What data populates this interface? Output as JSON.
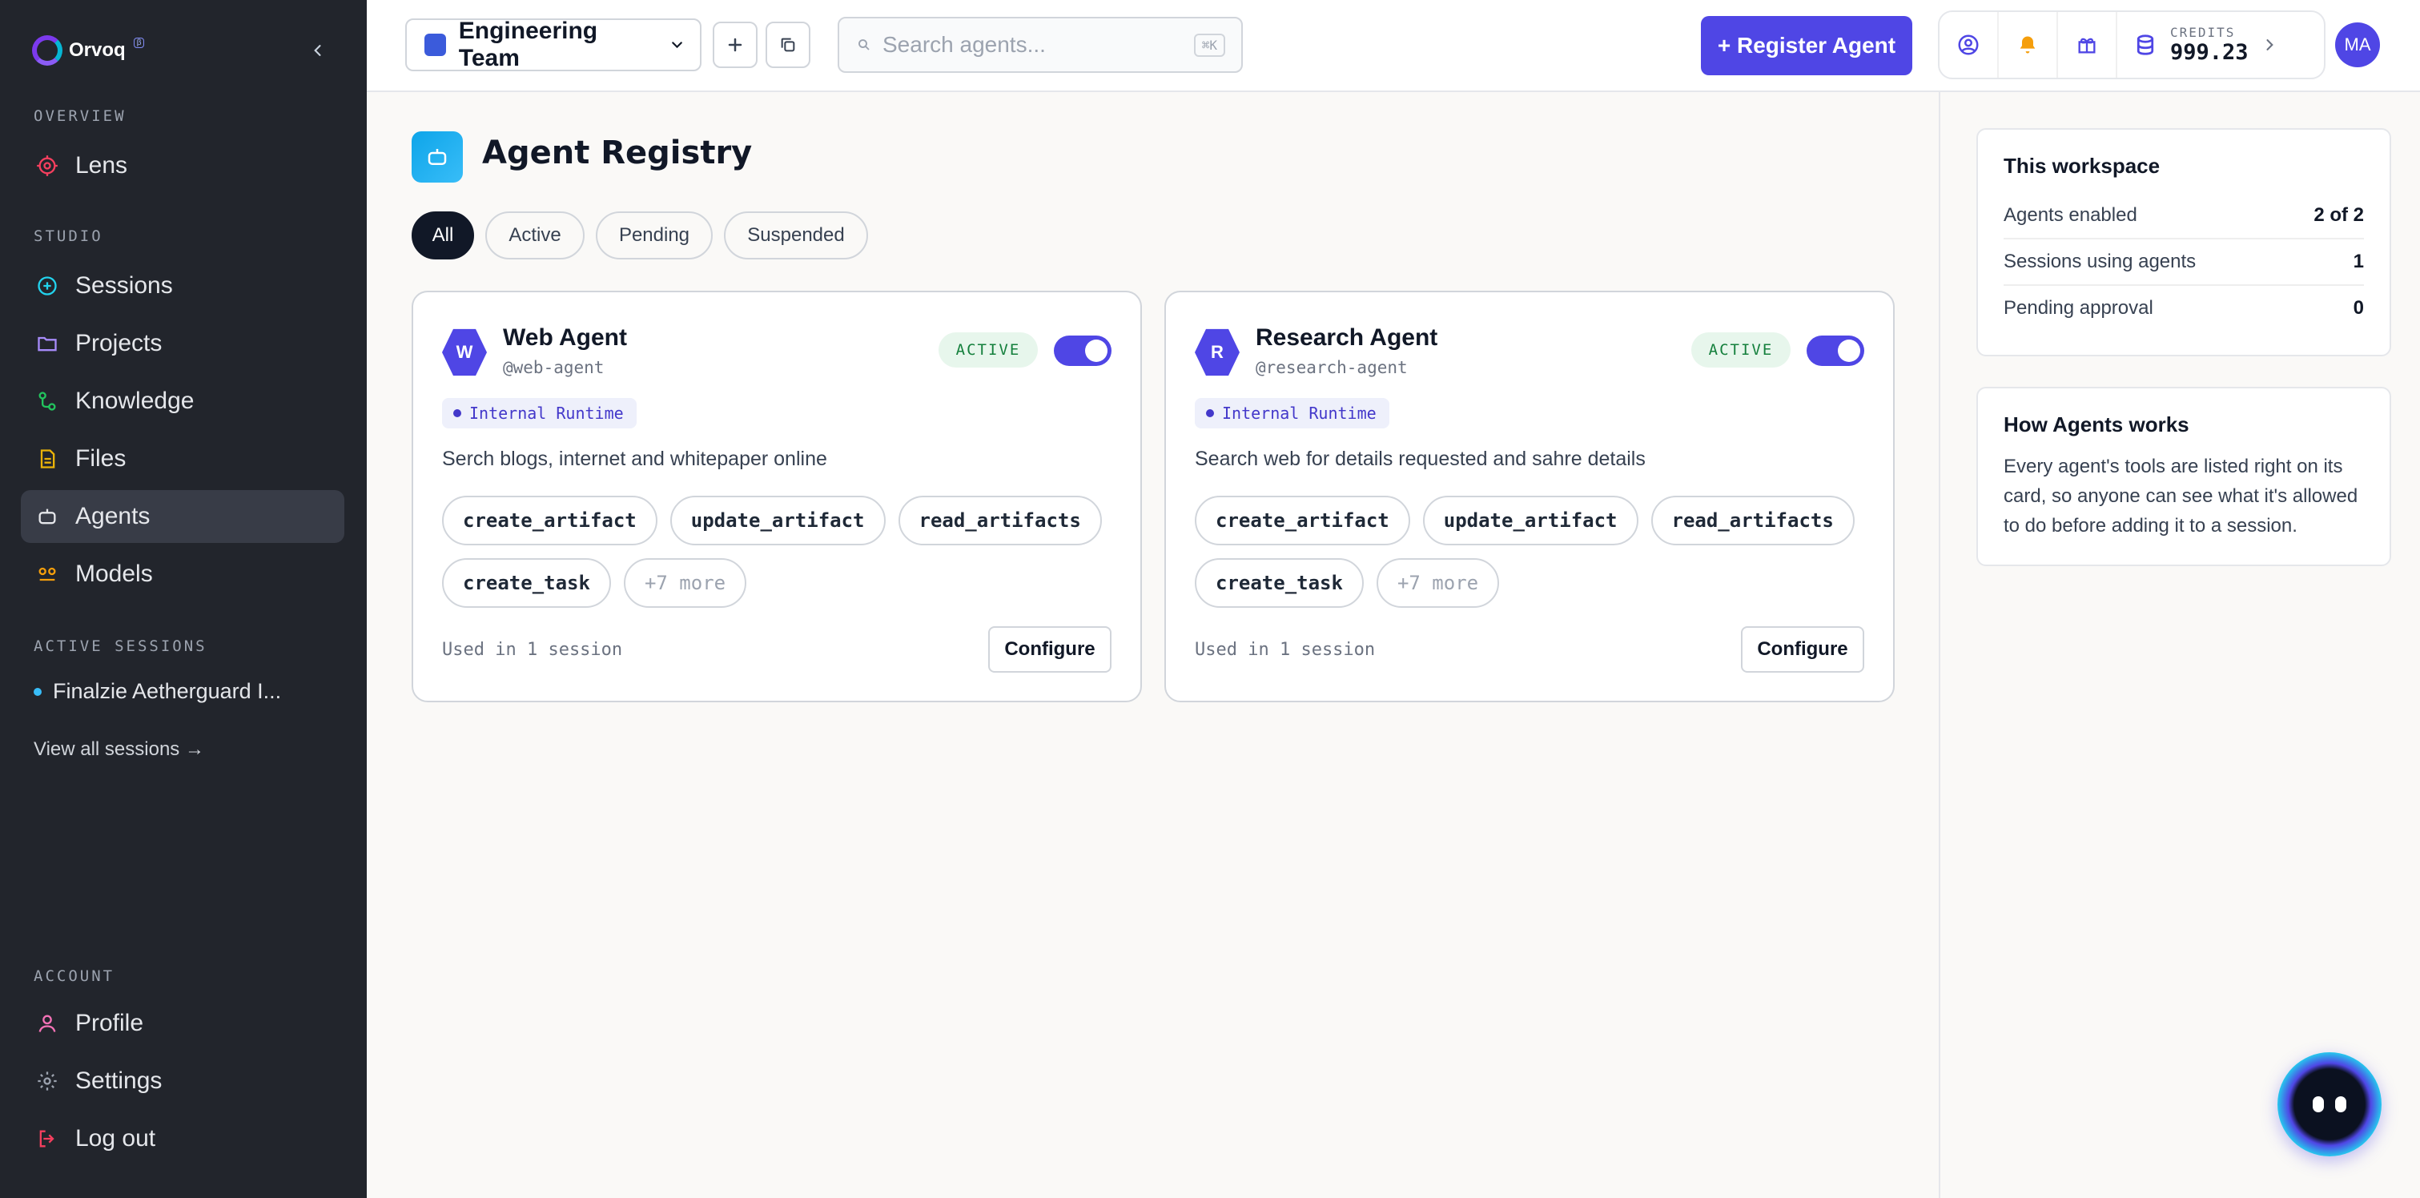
{
  "app": {
    "name": "Orvoq",
    "badge": "β"
  },
  "sidebar": {
    "overview_label": "OVERVIEW",
    "studio_label": "STUDIO",
    "active_sessions_label": "ACTIVE SESSIONS",
    "account_label": "ACCOUNT",
    "items": [
      {
        "label": "Lens",
        "icon": "target-icon"
      },
      {
        "label": "Sessions",
        "icon": "plus-circle-icon"
      },
      {
        "label": "Projects",
        "icon": "folder-icon"
      },
      {
        "label": "Knowledge",
        "icon": "graph-icon"
      },
      {
        "label": "Files",
        "icon": "file-icon"
      },
      {
        "label": "Agents",
        "icon": "robot-icon"
      },
      {
        "label": "Models",
        "icon": "models-icon"
      }
    ],
    "active_session": "Finalzie Aetherguard I...",
    "view_all": "View all sessions →",
    "account_items": [
      {
        "label": "Profile",
        "icon": "user-icon"
      },
      {
        "label": "Settings",
        "icon": "gear-icon"
      },
      {
        "label": "Log out",
        "icon": "logout-icon"
      }
    ]
  },
  "topbar": {
    "team": "Engineering Team",
    "search_placeholder": "Search agents...",
    "search_shortcut": "⌘K",
    "register_label": "+ Register Agent",
    "credits_label": "CREDITS",
    "credits_value": "999.23",
    "avatar_initials": "MA"
  },
  "page": {
    "title": "Agent Registry",
    "filters": [
      "All",
      "Active",
      "Pending",
      "Suspended"
    ],
    "selected_filter": "All"
  },
  "agents": [
    {
      "initial": "W",
      "name": "Web Agent",
      "handle": "@web-agent",
      "status": "ACTIVE",
      "enabled": true,
      "runtime": "Internal Runtime",
      "description": "Serch blogs, internet and whitepaper online",
      "tools": [
        "create_artifact",
        "update_artifact",
        "read_artifacts",
        "create_task"
      ],
      "more": "+7 more",
      "usage": "Used in 1 session",
      "configure": "Configure"
    },
    {
      "initial": "R",
      "name": "Research Agent",
      "handle": "@research-agent",
      "status": "ACTIVE",
      "enabled": true,
      "runtime": "Internal Runtime",
      "description": "Search web for details requested and sahre details",
      "tools": [
        "create_artifact",
        "update_artifact",
        "read_artifacts",
        "create_task"
      ],
      "more": "+7 more",
      "usage": "Used in 1 session",
      "configure": "Configure"
    }
  ],
  "workspace": {
    "title": "This workspace",
    "rows": [
      {
        "label": "Agents enabled",
        "value": "2 of 2"
      },
      {
        "label": "Sessions using agents",
        "value": "1"
      },
      {
        "label": "Pending approval",
        "value": "0"
      }
    ]
  },
  "how": {
    "title": "How Agents works",
    "text": "Every agent's tools are listed right on its card, so anyone can see what it's allowed to do before adding it to a session."
  },
  "colors": {
    "accent": "#4f46e5",
    "sidebar": "#22252c",
    "active_badge_bg": "#e7f6ec",
    "active_badge_text": "#15803d"
  }
}
